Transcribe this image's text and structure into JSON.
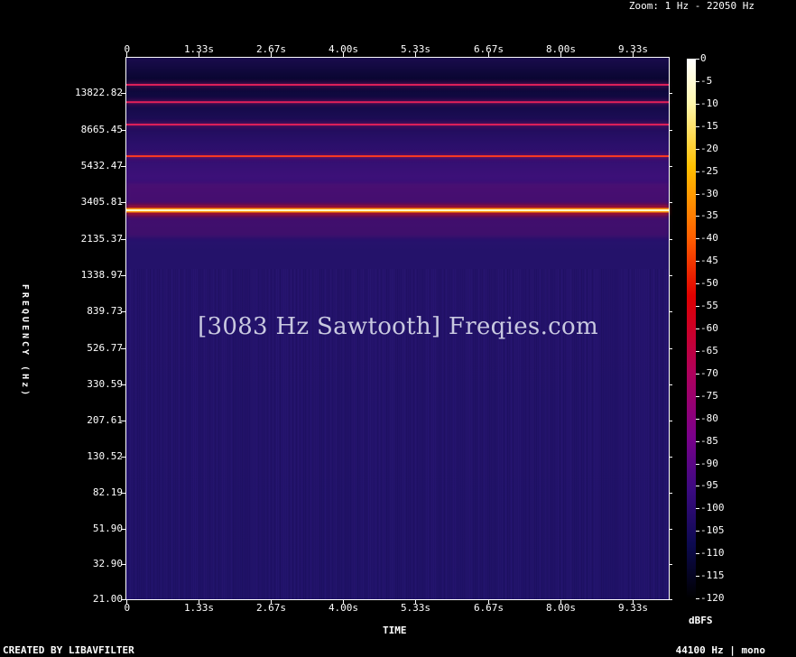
{
  "header": {
    "zoom_text": "Zoom: 1 Hz - 22050 Hz"
  },
  "footer": {
    "created_by": "CREATED BY LIBAVFILTER",
    "format": "44100 Hz | mono"
  },
  "watermark": "[3083 Hz Sawtooth] Freqies.com",
  "colors": {
    "background": "#000000",
    "axis": "#ffffff",
    "noise_floor": "#22136a",
    "peak": "#fff8c8"
  },
  "chart_data": {
    "type": "heatmap",
    "title": "",
    "xlabel": "TIME",
    "ylabel": "FREQUENCY (Hz)",
    "colorbar_label": "dBFS",
    "x_ticks": [
      "0",
      "1.33s",
      "2.67s",
      "4.00s",
      "5.33s",
      "6.67s",
      "8.00s",
      "9.33s"
    ],
    "x_tick_values": [
      0,
      1.33,
      2.67,
      4.0,
      5.33,
      6.67,
      8.0,
      9.33
    ],
    "xlim": [
      0,
      10
    ],
    "y_scale": "log",
    "y_ticks": [
      "13822.82",
      "8665.45",
      "5432.47",
      "3405.81",
      "2135.37",
      "1338.97",
      "839.73",
      "526.77",
      "330.59",
      "207.61",
      "130.52",
      "82.19",
      "51.90",
      "32.90",
      "21.00"
    ],
    "y_tick_values": [
      13822.82,
      8665.45,
      5432.47,
      3405.81,
      2135.37,
      1338.97,
      839.73,
      526.77,
      330.59,
      207.61,
      130.52,
      82.19,
      51.9,
      32.9,
      21.0
    ],
    "ylim": [
      21,
      22050
    ],
    "colorbar_ticks": [
      "0",
      "-5",
      "-10",
      "-15",
      "-20",
      "-25",
      "-30",
      "-35",
      "-40",
      "-45",
      "-50",
      "-55",
      "-60",
      "-65",
      "-70",
      "-75",
      "-80",
      "-85",
      "-90",
      "-95",
      "-100",
      "-105",
      "-110",
      "-115",
      "-120"
    ],
    "colorbar_range": [
      -120,
      0
    ],
    "harmonics": [
      {
        "frequency_hz": 3083,
        "level_dbfs": -25
      },
      {
        "frequency_hz": 6166,
        "level_dbfs": -45
      },
      {
        "frequency_hz": 9249,
        "level_dbfs": -50
      },
      {
        "frequency_hz": 12332,
        "level_dbfs": -52
      },
      {
        "frequency_hz": 15415,
        "level_dbfs": -53
      }
    ],
    "noise_floor_dbfs": -100
  }
}
